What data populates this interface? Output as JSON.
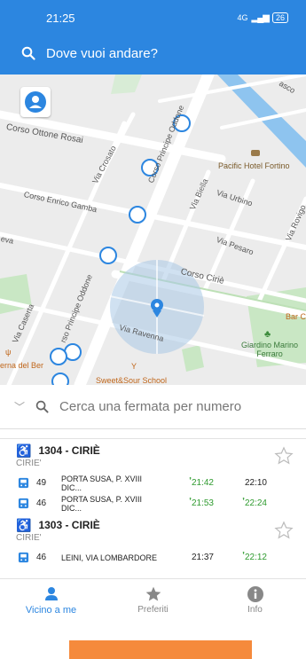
{
  "status": {
    "time": "21:25",
    "network": "4G",
    "battery": "26"
  },
  "search": {
    "placeholder": "Dove vuoi andare?"
  },
  "map": {
    "labels": {
      "corso_ottone_rosai": "Corso Ottone Rosai",
      "via_crosato": "Via Crosato",
      "corso_principe_oddone_top": "Corso Principe Oddone",
      "corso_enrico_gamba": "Corso Enrico Gamba",
      "via_biella": "Via Biella",
      "via_urbino": "Via Urbino",
      "pacific_hotel": "Pacific Hotel Fortino",
      "via_pesaro": "Via Pesaro",
      "via_rovigo": "Via Rovigo",
      "corso_cirie": "Corso Ciriè",
      "via_caserta": "Via Caserta",
      "corso_principe_oddone_bottom": "rso Principe Oddone",
      "via_ravenna": "Via Ravenna",
      "giardino": "Giardino Marino Ferraro",
      "bar": "Bar C",
      "taverna": "erna del Ber",
      "sweet_sour": "Sweet&Sour School",
      "vasco": "asco",
      "eva": "eva"
    }
  },
  "fermata_search": {
    "placeholder": "Cerca una fermata per numero"
  },
  "stops": [
    {
      "title": "1304 - CIRIÈ",
      "town": "CIRIE'",
      "lines": [
        {
          "number": "49",
          "destination": "PORTA SUSA, P. XVIII DIC...",
          "time1": "21:42",
          "time1_realtime": true,
          "time2": "22:10",
          "time2_realtime": false
        },
        {
          "number": "46",
          "destination": "PORTA SUSA, P. XVIII DIC...",
          "time1": "21:53",
          "time1_realtime": true,
          "time2": "22:24",
          "time2_realtime": true
        }
      ]
    },
    {
      "title": "1303 - CIRIÈ",
      "town": "CIRIE'",
      "lines": [
        {
          "number": "46",
          "destination": "LEINI, VIA LOMBARDORE",
          "time1": "21:37",
          "time1_realtime": false,
          "time2": "22:12",
          "time2_realtime": true
        }
      ]
    }
  ],
  "tabs": {
    "nearby": "Vicino a me",
    "favorites": "Preferiti",
    "info": "Info"
  },
  "colors": {
    "primary": "#2c86e0",
    "realtime": "#2e9a2e",
    "accent": "#f58a3c"
  }
}
